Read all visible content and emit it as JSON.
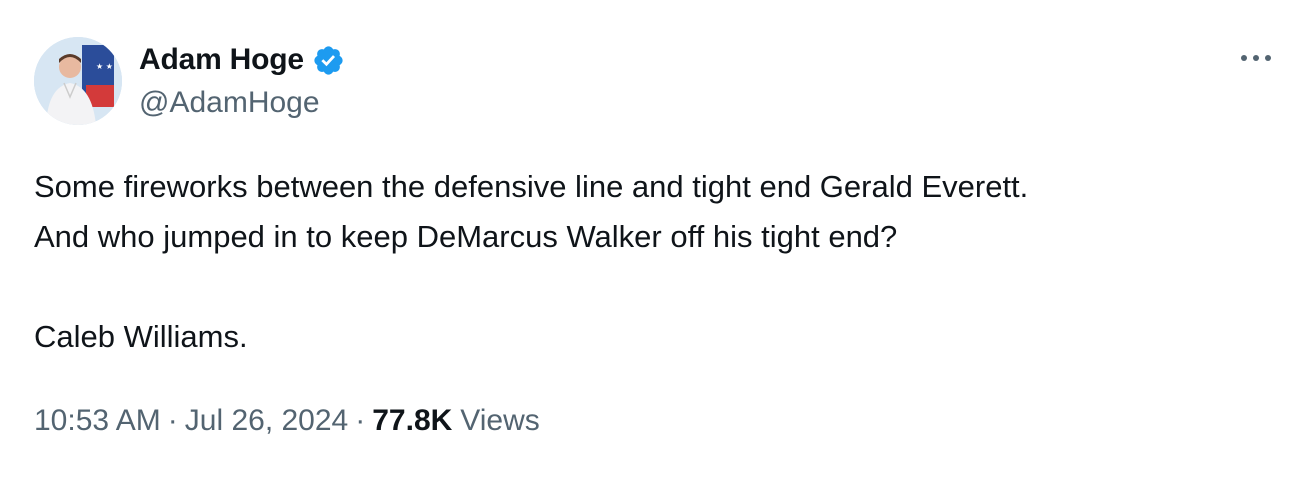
{
  "author": {
    "display_name": "Adam Hoge",
    "handle": "@AdamHoge",
    "verified": true,
    "verified_color": "#1d9bf0"
  },
  "tweet": {
    "lines": [
      "Some fireworks between the defensive line and tight end Gerald Everett.",
      "And who jumped in to keep DeMarcus Walker off his tight end?",
      "Caleb Williams."
    ]
  },
  "meta": {
    "time": "10:53 AM",
    "separator": "·",
    "date": "Jul 26, 2024",
    "views_count": "77.8K",
    "views_label": "Views"
  },
  "icons": {
    "more": "more-horizontal-icon",
    "verified": "verified-badge-icon"
  },
  "colors": {
    "text_primary": "#0f1419",
    "text_secondary": "#536471",
    "background": "#ffffff"
  }
}
